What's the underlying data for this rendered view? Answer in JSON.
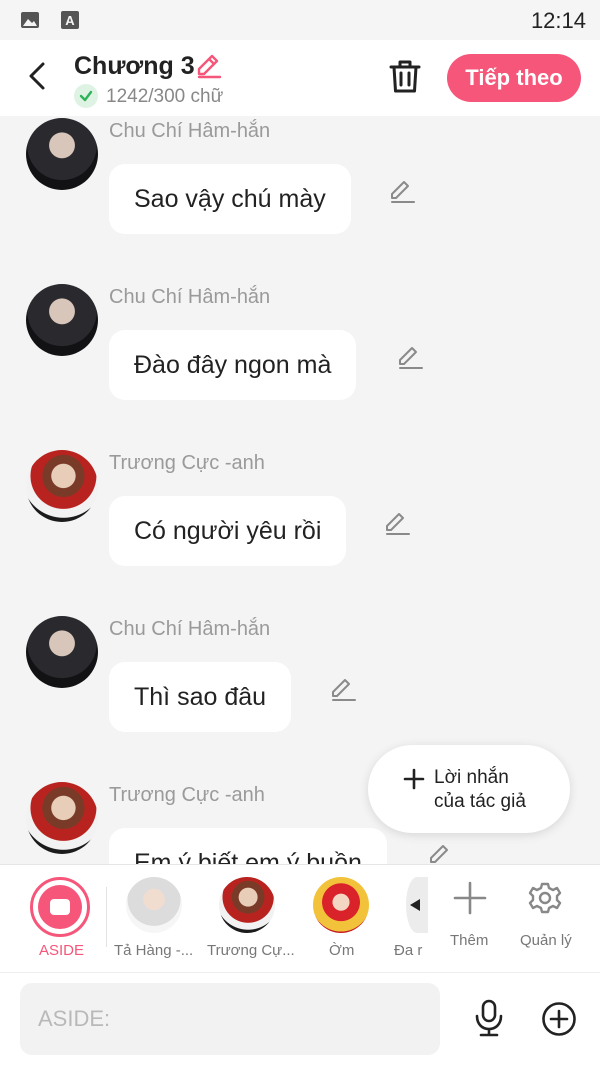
{
  "status": {
    "time": "12:14",
    "icons": [
      "image-icon",
      "keyboard-a-icon"
    ]
  },
  "header": {
    "title": "Chương 3",
    "word_count": "1242/300 chữ",
    "next_label": "Tiếp theo",
    "icons": [
      "back-icon",
      "pencil-icon",
      "trash-icon",
      "check-icon"
    ]
  },
  "messages": [
    {
      "name": "Chu Chí Hâm-hắn",
      "text": "Sao vậy chú mày"
    },
    {
      "name": "Chu Chí Hâm-hắn",
      "text": "Đào đây ngon mà"
    },
    {
      "name": "Trương Cực -anh",
      "text": "Có người yêu rồi"
    },
    {
      "name": "Chu Chí Hâm-hắn",
      "text": "Thì sao đâu"
    },
    {
      "name": "Trương Cực -anh",
      "text": "Em ý biết em ý buồn"
    }
  ],
  "fab": {
    "line1": "Lời nhắn",
    "line2": "của tác giả"
  },
  "characters": {
    "aside_label": "ASIDE",
    "items": [
      {
        "label": "Tả Hàng -..."
      },
      {
        "label": "Trương Cự..."
      },
      {
        "label": "Ờm"
      },
      {
        "label": "Đa r"
      }
    ],
    "add_label": "Thêm",
    "manage_label": "Quản lý"
  },
  "input": {
    "placeholder": "ASIDE:"
  },
  "colors": {
    "accent": "#f5567a",
    "check": "#2fb35a"
  }
}
